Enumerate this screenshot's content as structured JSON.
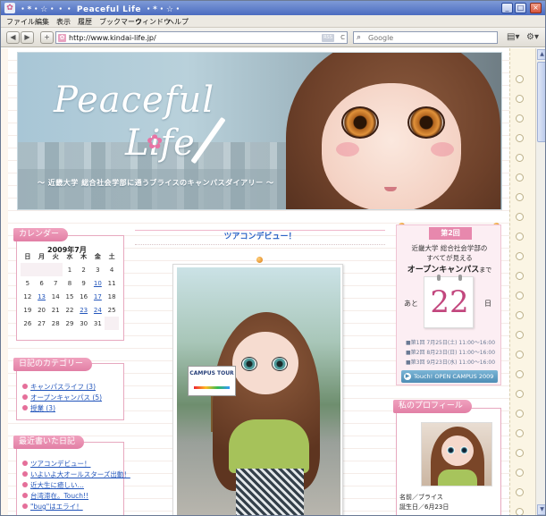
{
  "window": {
    "title": "・*・☆・・・ Peaceful Life ・*・☆・",
    "buttons": [
      "_",
      "□",
      "×"
    ]
  },
  "menubar": {
    "items": [
      "ファイル",
      "編集",
      "表示",
      "履歴",
      "ブックマーク",
      "ウィンドウ",
      "ヘルプ"
    ]
  },
  "toolbar": {
    "back": "◀",
    "forward": "▶",
    "add_tab": "+",
    "url": "http://www.kindai-life.jp/",
    "rss": "RSS",
    "go": "C",
    "search_placeholder": "Google",
    "page_icon": "page-icon",
    "gear_icon": "gear-icon"
  },
  "banner": {
    "logo_line1": "Peaceful",
    "logo_line2": "Life",
    "subtitle": "〜 近畿大学 総合社会学部に通うブライスのキャンパスダイアリー 〜"
  },
  "sidebar_left": {
    "calendar": {
      "header": "カレンダー",
      "month": "2009年7月",
      "weekdays": [
        "日",
        "月",
        "火",
        "水",
        "木",
        "金",
        "土"
      ],
      "weeks": [
        [
          "",
          "",
          "",
          "1",
          "2",
          "3",
          "4"
        ],
        [
          "5",
          "6",
          "7",
          "8",
          "9",
          "10",
          "11"
        ],
        [
          "12",
          "13",
          "14",
          "15",
          "16",
          "17",
          "18"
        ],
        [
          "19",
          "20",
          "21",
          "22",
          "23",
          "24",
          "25"
        ],
        [
          "26",
          "27",
          "28",
          "29",
          "30",
          "31",
          ""
        ]
      ],
      "linked_days": [
        "10",
        "13",
        "17",
        "23",
        "24"
      ]
    },
    "categories": {
      "header": "日記のカテゴリー",
      "items": [
        "キャンパスライフ (3)",
        "オープンキャンパス (5)",
        "授業 (3)"
      ]
    },
    "recent": {
      "header": "最近書いた日記",
      "items": [
        "ツアコンデビュー！",
        "いよいよ大オールスターズ出動！",
        "近大生に癒しい…",
        "台湾滞在。Touch!!",
        "\"bug\"はエライ！"
      ]
    }
  },
  "post": {
    "title": "ツアコンデビュー！",
    "sign_text": "CAMPUS TOUR"
  },
  "sidebar_right": {
    "countdown": {
      "badge": "第2回",
      "line1": "近畿大学 総合社会学部の",
      "line2": "すべてが見える",
      "line3": "オープンキャンパス",
      "line3_suffix": "まで",
      "prefix": "あと",
      "days": "22",
      "suffix": "日",
      "dates": [
        "■第1回 7月25日(土) 11:00〜16:00",
        "■第2回 8月23日(日) 11:00〜16:00",
        "■第3回 9月23日(水) 11:00〜16:00"
      ],
      "button": "Touch! OPEN CAMPUS 2009"
    },
    "profile": {
      "header": "私のプロフィール",
      "name": "名前／ブライス",
      "birthday": "誕生日／6月23日"
    }
  },
  "colors": {
    "accent_pink": "#e27fa5",
    "link_blue": "#2255bb",
    "title_blue": "#2a63c6",
    "countdown_number": "#c2477e"
  }
}
